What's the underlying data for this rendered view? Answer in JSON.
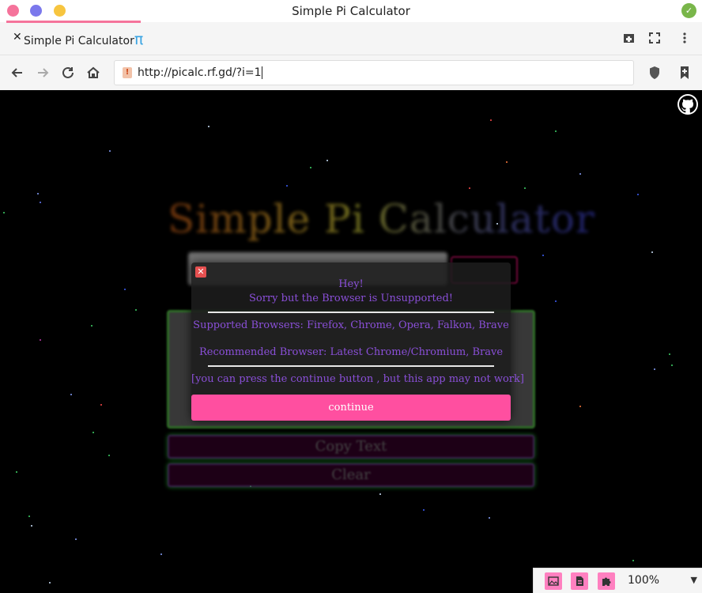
{
  "window": {
    "title": "Simple Pi Calculator"
  },
  "tab": {
    "close_glyph": "✕",
    "title": "Simple Pi Calculator",
    "pi_glyph": "π"
  },
  "toolbar": {
    "new_tab_icon": "new-tab-icon",
    "fullscreen_icon": "fullscreen-icon",
    "menu_icon": "menu-icon"
  },
  "nav": {
    "url": "http://picalc.rf.gd/?i=1"
  },
  "page": {
    "bg_title": "Simple Pi Calculator",
    "copy_label": "Copy Text",
    "clear_label": "Clear"
  },
  "modal": {
    "greeting": "Hey!",
    "unsupported": "Sorry but the Browser is Unsupported!",
    "supported": "Supported Browsers: Firefox, Chrome, Opera, Falkon, Brave",
    "recommended": "Recommended Browser: Latest Chrome/Chromium, Brave",
    "note": "[you can press the continue button , but this app may not work]",
    "continue_label": "continue"
  },
  "statusbar": {
    "zoom": "100%"
  },
  "colors": {
    "accent_pink": "#ff4fa0",
    "modal_text": "#8a4fd8",
    "tab_accent": "#f5739b"
  }
}
